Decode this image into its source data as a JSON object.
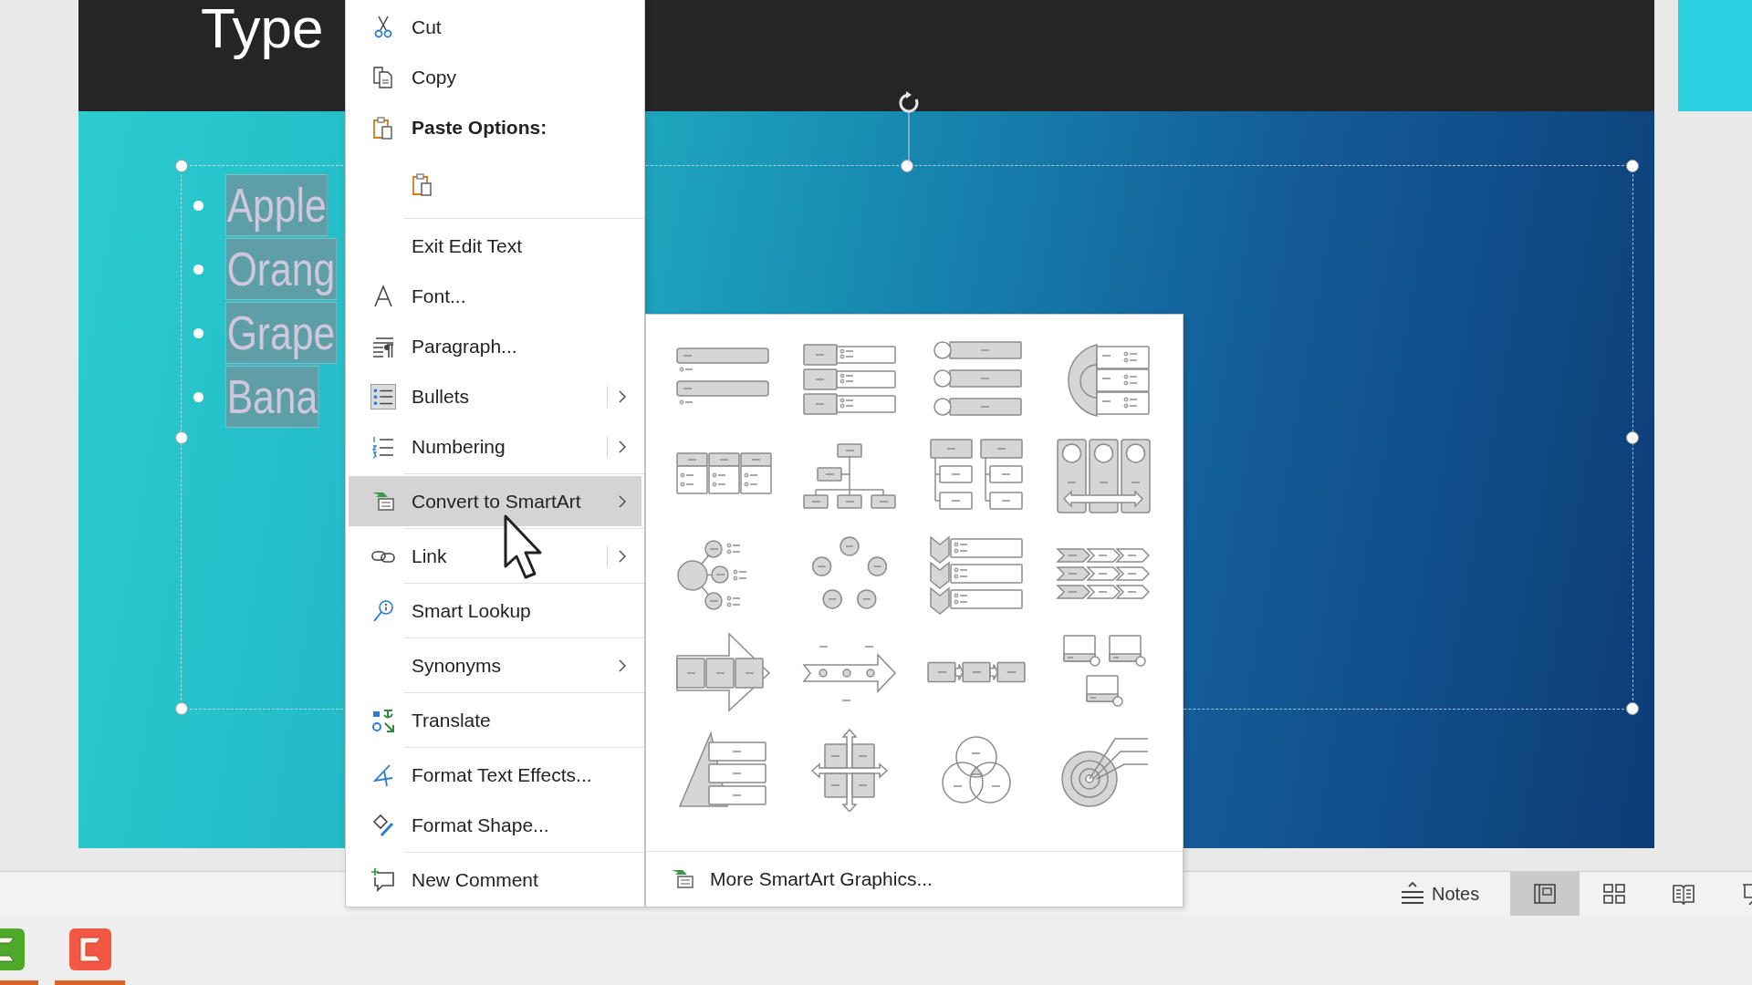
{
  "slide": {
    "title": "Type",
    "bullets": [
      {
        "text": "Apple",
        "highlighted": true
      },
      {
        "text": "Orang",
        "highlighted": true
      },
      {
        "text": "Grape",
        "highlighted": true
      },
      {
        "text": "Bana",
        "highlighted": true
      }
    ]
  },
  "context_menu": {
    "sections": [
      {
        "items": [
          {
            "kind": "item",
            "label": "Cut",
            "submenu": false,
            "split": false,
            "selected": false,
            "checked": false
          },
          {
            "kind": "item",
            "label": "Copy",
            "submenu": false,
            "split": false,
            "selected": false,
            "checked": false
          },
          {
            "kind": "heading",
            "label": "Paste Options:"
          },
          {
            "kind": "paste-option",
            "selected": false
          }
        ]
      },
      {
        "items": [
          {
            "kind": "item",
            "label": "Exit Edit Text",
            "submenu": false,
            "split": false,
            "selected": false,
            "checked": false
          },
          {
            "kind": "item",
            "label": "Font...",
            "submenu": false,
            "split": false,
            "selected": false,
            "checked": false
          },
          {
            "kind": "item",
            "label": "Paragraph...",
            "submenu": false,
            "split": false,
            "selected": false,
            "checked": false
          },
          {
            "kind": "item",
            "label": "Bullets",
            "submenu": true,
            "split": true,
            "selected": false,
            "checked": true
          },
          {
            "kind": "item",
            "label": "Numbering",
            "submenu": true,
            "split": true,
            "selected": false,
            "checked": false
          }
        ]
      },
      {
        "items": [
          {
            "kind": "item",
            "label": "Convert to SmartArt",
            "submenu": true,
            "split": false,
            "selected": true,
            "checked": false
          }
        ]
      },
      {
        "items": [
          {
            "kind": "item",
            "label": "Link",
            "submenu": true,
            "split": true,
            "selected": false,
            "checked": false
          }
        ]
      },
      {
        "items": [
          {
            "kind": "item",
            "label": "Smart Lookup",
            "submenu": false,
            "split": false,
            "selected": false,
            "checked": false
          }
        ]
      },
      {
        "items": [
          {
            "kind": "item",
            "label": "Synonyms",
            "submenu": true,
            "split": false,
            "selected": false,
            "checked": false
          }
        ]
      },
      {
        "items": [
          {
            "kind": "item",
            "label": "Translate",
            "submenu": false,
            "split": false,
            "selected": false,
            "checked": false
          }
        ]
      },
      {
        "items": [
          {
            "kind": "item",
            "label": "Format Text Effects...",
            "submenu": false,
            "split": false,
            "selected": false,
            "checked": false
          },
          {
            "kind": "item",
            "label": "Format Shape...",
            "submenu": false,
            "split": false,
            "selected": false,
            "checked": false
          }
        ]
      },
      {
        "items": [
          {
            "kind": "item",
            "label": "New Comment",
            "submenu": false,
            "split": false,
            "selected": false,
            "checked": false
          }
        ]
      }
    ]
  },
  "smartart_submenu": {
    "layouts": [
      {
        "selected": false
      },
      {
        "selected": false
      },
      {
        "selected": false
      },
      {
        "selected": false
      },
      {
        "selected": false
      },
      {
        "selected": false
      },
      {
        "selected": false
      },
      {
        "selected": false
      },
      {
        "selected": false
      },
      {
        "selected": false
      },
      {
        "selected": false
      },
      {
        "selected": false
      },
      {
        "selected": false
      },
      {
        "selected": false
      },
      {
        "selected": false
      },
      {
        "selected": false
      },
      {
        "selected": false
      },
      {
        "selected": false
      },
      {
        "selected": false
      },
      {
        "selected": false
      }
    ],
    "more_label": "More SmartArt Graphics..."
  },
  "status_bar": {
    "notes_label": "Notes",
    "views": [
      {
        "selected": true
      },
      {
        "selected": false
      },
      {
        "selected": false
      },
      {
        "selected": false
      }
    ]
  },
  "taskbar": {
    "apps": [
      {
        "running": true
      },
      {
        "running": true
      }
    ]
  }
}
